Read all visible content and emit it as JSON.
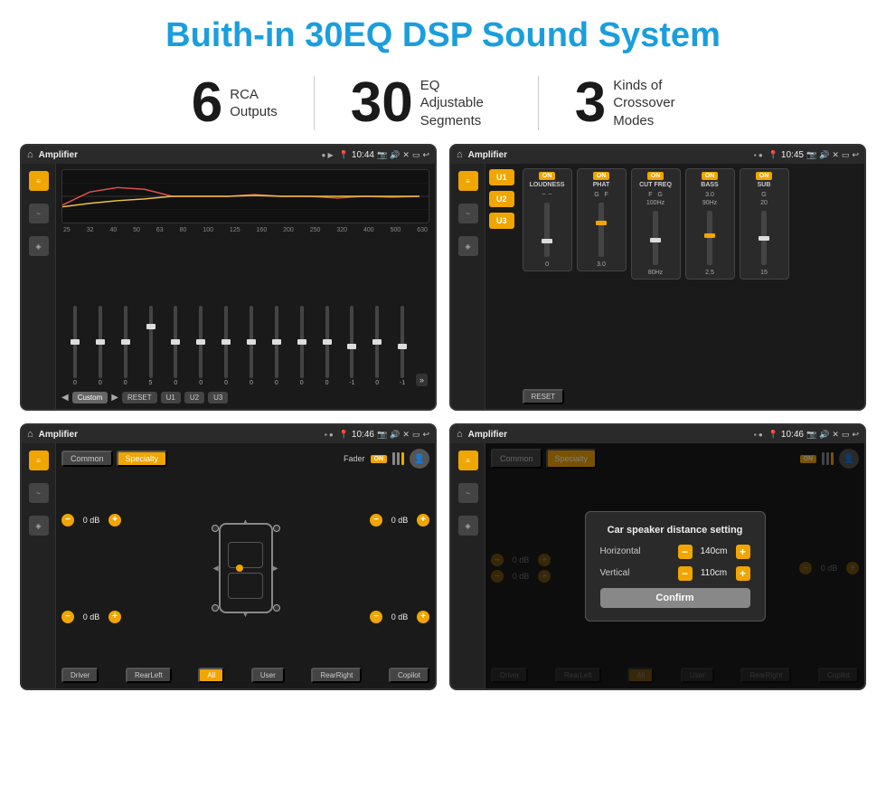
{
  "page": {
    "title": "Buith-in 30EQ DSP Sound System"
  },
  "stats": [
    {
      "number": "6",
      "label": "RCA\nOutputs"
    },
    {
      "number": "30",
      "label": "EQ Adjustable\nSegments"
    },
    {
      "number": "3",
      "label": "Kinds of\nCrossover Modes"
    }
  ],
  "screens": {
    "eq": {
      "title": "Amplifier",
      "time": "10:44",
      "frequencies": [
        "25",
        "32",
        "40",
        "50",
        "63",
        "80",
        "100",
        "125",
        "160",
        "200",
        "250",
        "320",
        "400",
        "500",
        "630"
      ],
      "values": [
        "0",
        "0",
        "0",
        "5",
        "0",
        "0",
        "0",
        "0",
        "0",
        "0",
        "0",
        "-1",
        "0",
        "-1"
      ],
      "presets": [
        "Custom",
        "RESET",
        "U1",
        "U2",
        "U3"
      ]
    },
    "crossover": {
      "title": "Amplifier",
      "time": "10:45",
      "modes": [
        "U1",
        "U2",
        "U3"
      ],
      "modules": [
        "LOUDNESS",
        "PHAT",
        "CUT FREQ",
        "BASS",
        "SUB"
      ],
      "reset": "RESET"
    },
    "fader": {
      "title": "Amplifier",
      "time": "10:46",
      "tabs": [
        "Common",
        "Specialty"
      ],
      "activeTab": "Specialty",
      "faderLabel": "Fader",
      "onLabel": "ON",
      "dbs": [
        "0 dB",
        "0 dB",
        "0 dB",
        "0 dB"
      ],
      "bottomBtns": [
        "Driver",
        "RearLeft",
        "All",
        "User",
        "RearRight",
        "Copilot"
      ]
    },
    "distance": {
      "title": "Amplifier",
      "time": "10:46",
      "tabs": [
        "Common",
        "Specialty"
      ],
      "modal": {
        "title": "Car speaker distance setting",
        "horizontal_label": "Horizontal",
        "horizontal_value": "140cm",
        "vertical_label": "Vertical",
        "vertical_value": "110cm",
        "confirm_label": "Confirm"
      },
      "bottomBtns": [
        "Driver",
        "RearLeft",
        "All",
        "User",
        "RearRight",
        "Copilot"
      ],
      "dbs": [
        "0 dB",
        "0 dB"
      ]
    }
  }
}
